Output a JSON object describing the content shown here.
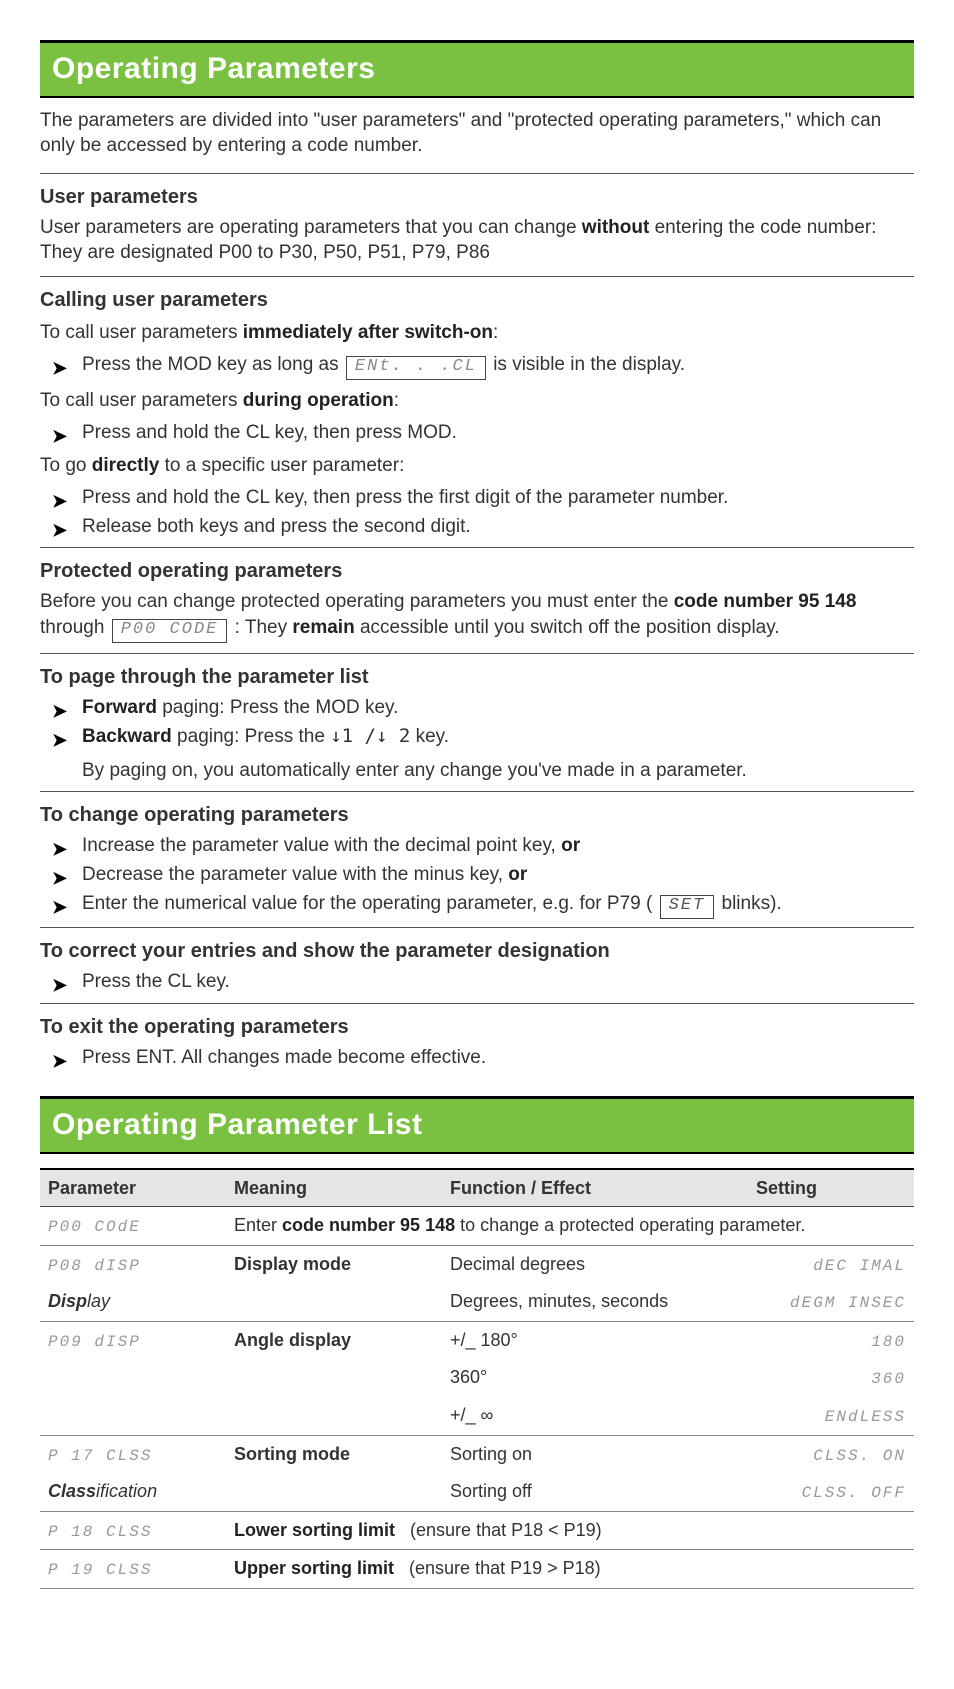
{
  "header1": "Operating Parameters",
  "intro": "The parameters are divided into \"user parameters\" and \"protected operating parameters,\" which can only be accessed by entering a code number.",
  "user_params": {
    "title": "User parameters",
    "body_a": "User parameters are operating parameters that you can change ",
    "body_bold": "without",
    "body_b": " entering the code number: They are designated P00 to P30, P50, P51, P79, P86"
  },
  "calling": {
    "title": "Calling user parameters",
    "line1_a": "To call user parameters ",
    "line1_b": "immediately after switch-on",
    "bullet1_a": "Press the MOD key as long as ",
    "lcd1": "ENt. . .CL",
    "bullet1_b": " is visible in the display.",
    "line2_a": "To call user parameters ",
    "line2_b": "during operation",
    "bullet2": "Press and hold the CL key, then press MOD.",
    "line3_a": "To go ",
    "line3_b": "directly",
    "line3_c": " to a specific user parameter:",
    "bullet3": "Press and hold the CL key, then press the first digit of the parameter number.",
    "bullet4": "Release both keys and press the second digit."
  },
  "protected": {
    "title": "Protected operating parameters",
    "a": "Before you can change protected operating parameters you must enter the ",
    "code_label": "code number 95 148",
    "b": " through ",
    "lcd": "P00  CODE",
    "c": " : They ",
    "remain": "remain",
    "d": " accessible until you switch off the position display."
  },
  "paging": {
    "title": "To page through the parameter list",
    "fwd_b": "Forward",
    "fwd_t": " paging: Press the MOD key.",
    "bwd_b": "Backward",
    "bwd_t_a": " paging: Press the ",
    "bwd_key": "↓1 /↓ 2",
    "bwd_t_b": " key.",
    "follow": "By paging on, you automatically enter any change you've made in a parameter."
  },
  "change": {
    "title": "To change operating parameters",
    "b1_a": "Increase the parameter value with the decimal point key, ",
    "or": "or",
    "b2_a": "Decrease the parameter value with the minus key, ",
    "b3_a": "Enter the numerical value for the operating parameter, e.g. for P79 ( ",
    "set": "SET",
    "b3_b": " blinks)."
  },
  "correct": {
    "title": "To correct your entries and show the parameter designation",
    "b1": "Press the CL key."
  },
  "exit": {
    "title": "To exit the operating parameters",
    "b1": "Press ENT. All changes made become effective."
  },
  "header2": "Operating Parameter List",
  "table": {
    "h": {
      "p": "Parameter",
      "m": "Meaning",
      "f": "Function / Effect",
      "s": "Setting"
    },
    "p00": {
      "code": "P00  COdE",
      "desc_a": "Enter ",
      "desc_b": "code number 95 148",
      "desc_c": " to change a protected operating parameter."
    },
    "p08": {
      "code": "P08  dISP",
      "sub_b": "Disp",
      "sub_i": "lay",
      "m": "Display mode",
      "r1_f": "Decimal degrees",
      "r1_s": "dEC IMAL",
      "r2_f": "Degrees, minutes, seconds",
      "r2_s": "dEGM INSEC"
    },
    "p09": {
      "code": "P09  dISP",
      "m": "Angle display",
      "r1_f": "+/_ 180°",
      "r1_s": "180",
      "r2_f": "360°",
      "r2_s": "360",
      "r3_f": "+/_ ∞",
      "r3_s": "ENdLESS"
    },
    "p17": {
      "code": "P 17  CLSS",
      "sub_b": "Class",
      "sub_i": "ification",
      "m": "Sorting mode",
      "r1_f": "Sorting on",
      "r1_s": "CLSS.   ON",
      "r2_f": "Sorting off",
      "r2_s": "CLSS.  OFF"
    },
    "p18": {
      "code": "P 18  CLSS",
      "m": "Lower sorting limit",
      "f": "(ensure that P18 < P19)"
    },
    "p19": {
      "code": "P 19  CLSS",
      "m": "Upper sorting limit",
      "f": "(ensure that P19 > P18)"
    }
  }
}
